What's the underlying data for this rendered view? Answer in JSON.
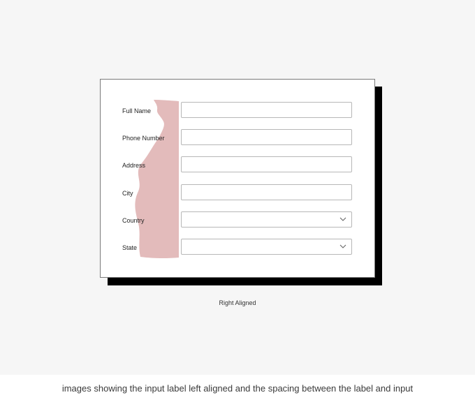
{
  "form": {
    "fields": [
      {
        "label": "Full Name",
        "type": "text"
      },
      {
        "label": "Phone Number",
        "type": "text"
      },
      {
        "label": "Address",
        "type": "text"
      },
      {
        "label": "City",
        "type": "text"
      },
      {
        "label": "Country",
        "type": "select"
      },
      {
        "label": "State",
        "type": "select"
      }
    ],
    "dropdown_icon": "chevron-down-icon"
  },
  "colors": {
    "spacing_highlight": "#e3bbbb",
    "background": "#f6f6f6",
    "card_shadow": "#000000"
  },
  "captions": {
    "diagram_caption": "Right Aligned",
    "description": "images showing the input label left aligned and the spacing between the label and input"
  }
}
